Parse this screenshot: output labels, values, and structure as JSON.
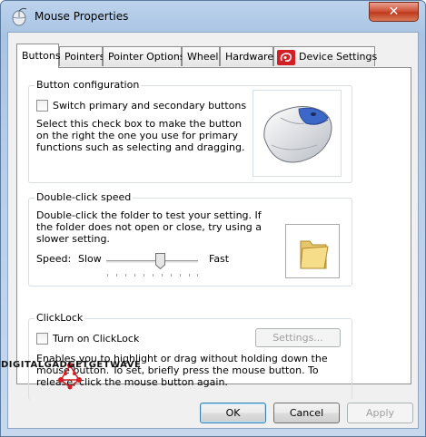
{
  "window": {
    "title": "Mouse Properties",
    "close_label": "✕"
  },
  "tabs": [
    {
      "label": "Buttons",
      "active": true
    },
    {
      "label": "Pointers"
    },
    {
      "label": "Pointer Options"
    },
    {
      "label": "Wheel"
    },
    {
      "label": "Hardware"
    },
    {
      "label": "Device Settings"
    }
  ],
  "button_configuration": {
    "title": "Button configuration",
    "checkbox_label": "Switch primary and secondary buttons",
    "checked": false,
    "description": "Select this check box to make the button on the right the one you use for primary functions such as selecting and dragging."
  },
  "double_click": {
    "title": "Double-click speed",
    "description": "Double-click the folder to test your setting. If the folder does not open or close, try using a slower setting.",
    "speed_label": "Speed:",
    "slow_label": "Slow",
    "fast_label": "Fast",
    "speed_fraction": 0.58
  },
  "clicklock": {
    "title": "ClickLock",
    "checkbox_label": "Turn on ClickLock",
    "checked": false,
    "settings_label": "Settings...",
    "description": "Enables you to highlight or drag without holding down the mouse button. To set, briefly press the mouse button. To release, click the mouse button again."
  },
  "footer": {
    "ok_label": "OK",
    "cancel_label": "Cancel",
    "apply_label": "Apply"
  },
  "watermark": {
    "text": "DIGITALGADGETGETWAVE"
  },
  "colors": {
    "accent": "#3c7fb1",
    "close": "#c03a1c",
    "logo_red": "#d21f26"
  }
}
